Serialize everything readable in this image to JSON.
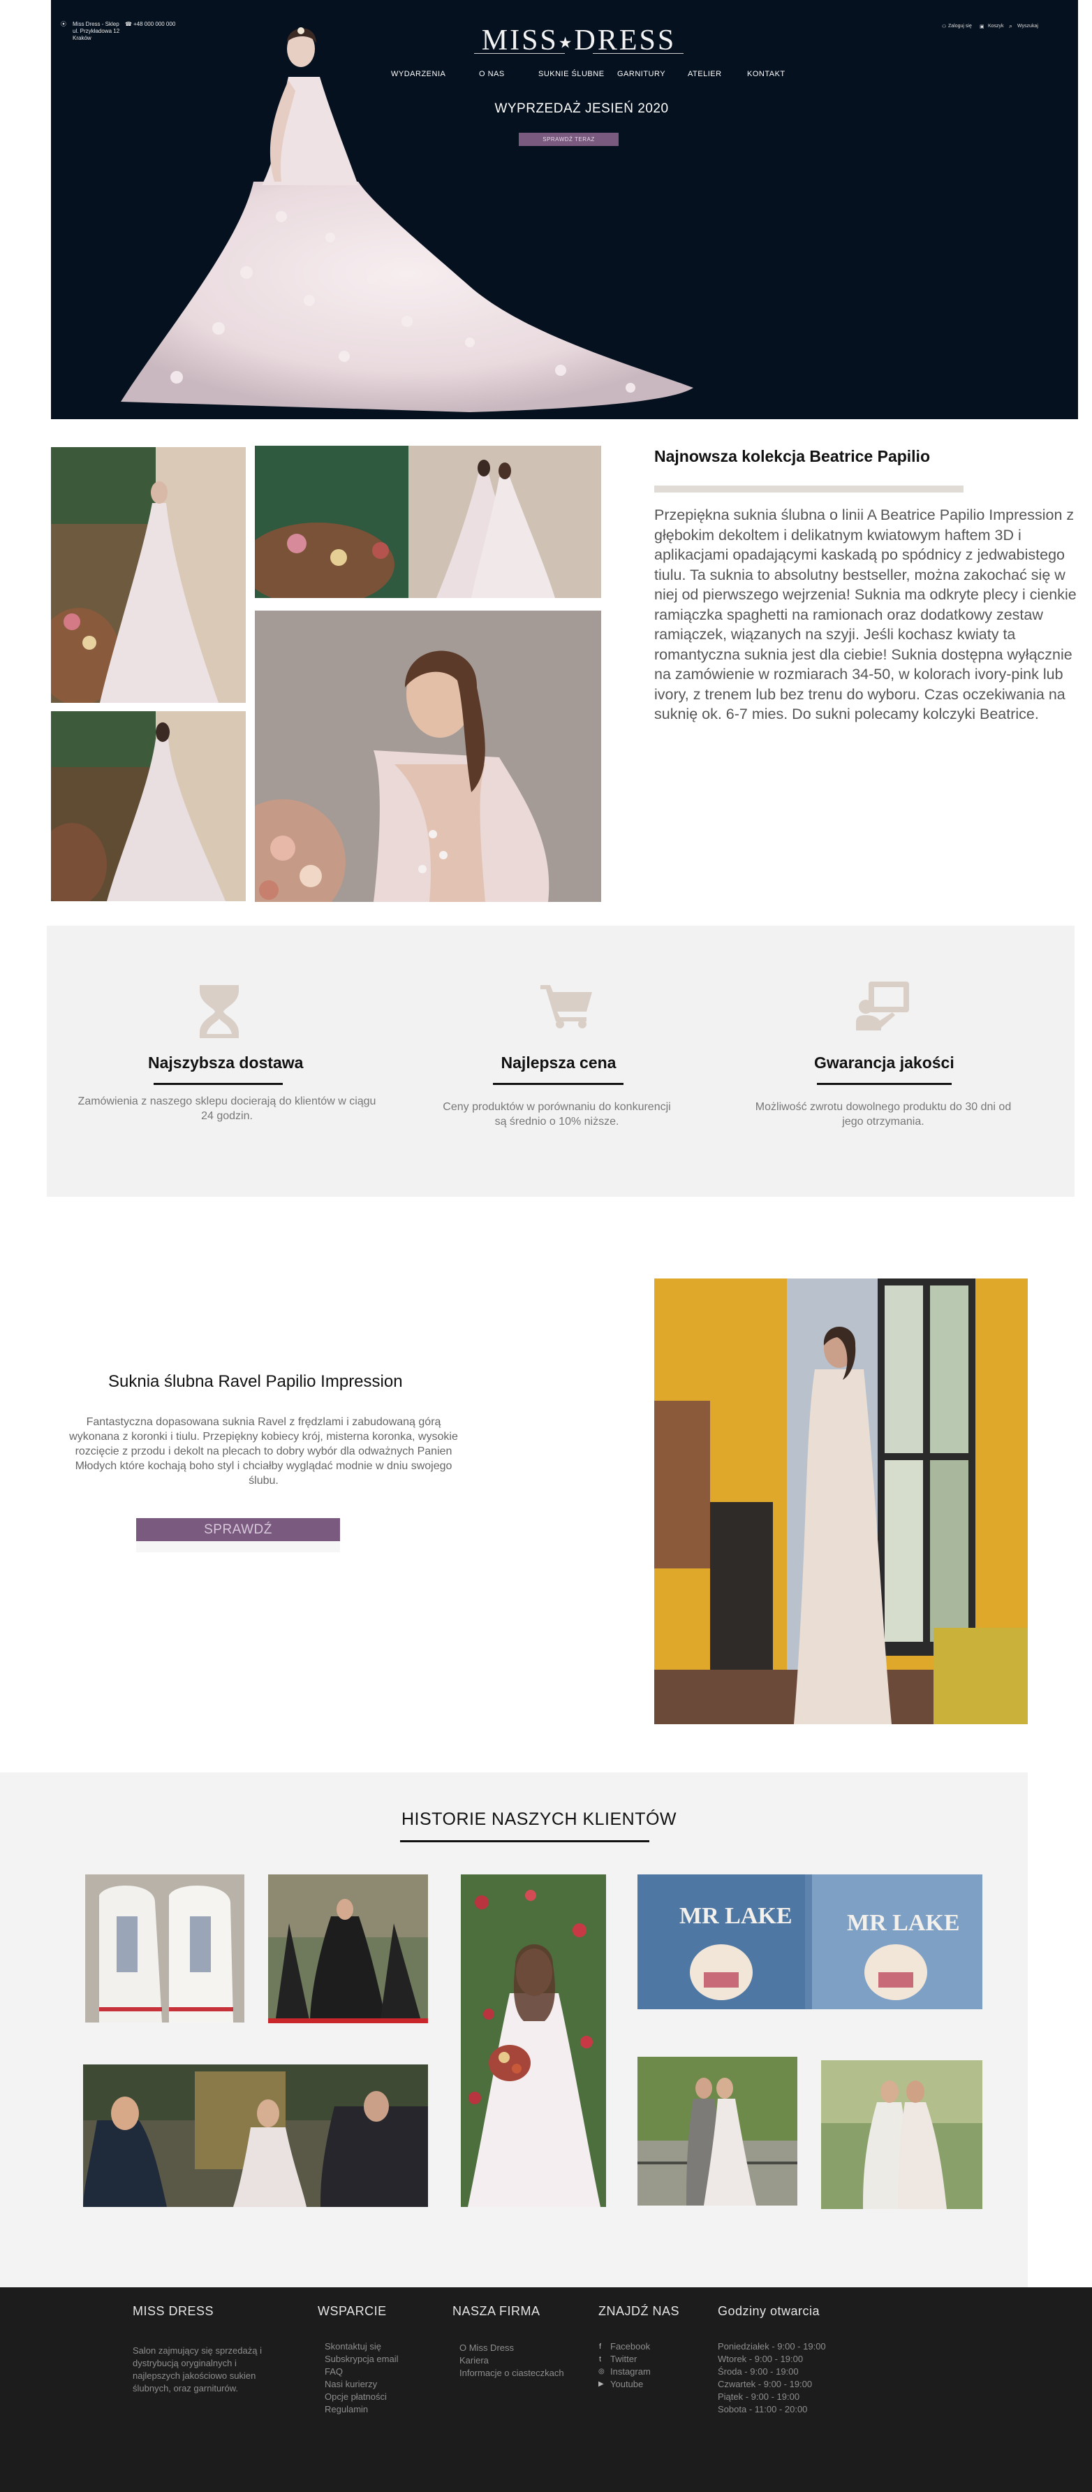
{
  "header": {
    "address_lines": [
      "Miss Dress - Sklep",
      "ul. Przykładowa 12",
      "Kraków"
    ],
    "phone": "+48 000 000 000",
    "logo_left": "MISS",
    "logo_star": "★",
    "logo_right": "DRESS",
    "user_links": [
      "Zaloguj się",
      "Koszyk",
      "Wyszukaj"
    ],
    "nav": [
      "WYDARZENIA",
      "O NAS",
      "SUKNIE ŚLUBNE",
      "GARNITURY",
      "ATELIER",
      "KONTAKT"
    ]
  },
  "hero": {
    "title": "WYPRZEDAŻ JESIEŃ 2020",
    "button": "SPRAWDŹ TERAZ"
  },
  "collection": {
    "title": "Najnowsza kolekcja Beatrice Papilio",
    "text": "Przepiękna suknia ślubna o linii A Beatrice Papilio Impression z głębokim dekoltem i delikatnym kwiatowym haftem 3D i aplikacjami opadającymi kaskadą po spódnicy z jedwabistego tiulu. Ta suknia to absolutny bestseller, można zakochać się w niej od pierwszego wejrzenia! Suknia ma odkryte plecy i cienkie ramiączka spaghetti na ramionach oraz dodatkowy zestaw ramiączek, wiązanych na szyji. Jeśli kochasz kwiaty ta romantyczna suknia jest dla ciebie! Suknia dostępna wyłącznie na zamówienie w rozmiarach 34-50, w kolorach ivory-pink lub ivory, z trenem lub bez trenu do wyboru. Czas oczekiwania na suknię ok. 6-7 mies. Do sukni polecamy kolczyki Beatrice."
  },
  "features": [
    {
      "icon": "hourglass-icon",
      "title": "Najszybsza dostawa",
      "text": "Zamówienia z naszego sklepu docierają do klientów w ciągu 24 godzin."
    },
    {
      "icon": "cart-icon",
      "title": "Najlepsza cena",
      "text": "Ceny produktów w porównaniu do konkurencji są średnio o 10% niższe."
    },
    {
      "icon": "guarantee-icon",
      "title": "Gwarancja jakości",
      "text": "Możliwość zwrotu dowolnego produktu do 30 dni od jego otrzymania."
    }
  ],
  "product": {
    "title": "Suknia ślubna Ravel Papilio Impression",
    "text": "Fantastyczna dopasowana suknia Ravel z frędzlami i zabudowaną górą wykonana z koronki i tiulu. Przepiękny kobiecy krój, misterna koronka, wysokie rozcięcie z przodu i dekolt na plecach to dobry wybór dla odważnych Panien Młodych które kochają boho styl i chciałby wyglądać modnie w dniu swojego ślubu.",
    "button": "SPRAWDŹ"
  },
  "stories": {
    "title": "HISTORIE NASZYCH KLIENTÓW",
    "jacket_text": "MR LAKE"
  },
  "footer": {
    "brand": {
      "heading": "MISS DRESS",
      "text": "Salon zajmujący się sprzedażą i dystrybucją oryginalnych i najlepszych jakościowo sukien ślubnych, oraz garniturów."
    },
    "support": {
      "heading": "WSPARCIE",
      "items": [
        "Skontaktuj się",
        "Subskrypcja email",
        "FAQ",
        "Nasi kurierzy",
        "Opcje płatności",
        "Regulamin"
      ]
    },
    "company": {
      "heading": "NASZA FIRMA",
      "items": [
        "O Miss Dress",
        "Kariera",
        "Informacje o ciasteczkach"
      ]
    },
    "social": {
      "heading": "ZNAJDŹ NAS",
      "items": [
        "Facebook",
        "Twitter",
        "Instagram",
        "Youtube"
      ],
      "glyphs": [
        "f",
        "t",
        "◎",
        "▶"
      ]
    },
    "hours": {
      "heading": "Godziny otwarcia",
      "items": [
        "Poniedziałek - 9:00 - 19:00",
        "Wtorek - 9:00 - 19:00",
        "Środa - 9:00 - 19:00",
        "Czwartek - 9:00 - 19:00",
        "Piątek - 9:00 - 19:00",
        "Sobota - 11:00 - 20:00"
      ]
    }
  },
  "colors": {
    "hero_bg": "#05111f",
    "accent_purple": "#7a5a7f",
    "icon_beige": "#d9cfc7",
    "footer_bg": "#1c1c1c",
    "section_gray": "#f2f2f2"
  }
}
